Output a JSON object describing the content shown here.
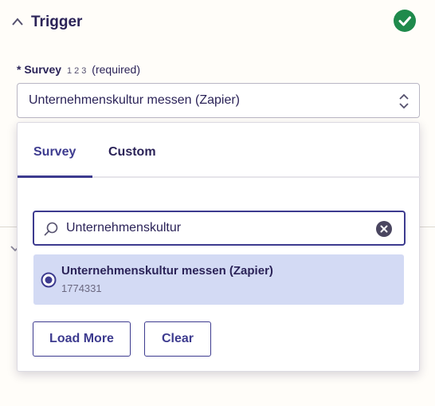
{
  "step": {
    "title": "Trigger",
    "status_icon": "check-circle-icon",
    "status_color": "#1f8a4c"
  },
  "field": {
    "required_marker": "*",
    "label": "Survey",
    "type_hint": "1 2 3",
    "required_text": "(required)",
    "selected_value": "Unternehmenskultur messen (Zapier)"
  },
  "dropdown": {
    "tabs": [
      {
        "label": "Survey",
        "active": true
      },
      {
        "label": "Custom",
        "active": false
      }
    ],
    "search": {
      "value": "Unternehmenskultur",
      "placeholder": ""
    },
    "results": [
      {
        "title": "Unternehmenskultur messen (Zapier)",
        "id": "1774331",
        "selected": true
      }
    ],
    "buttons": {
      "load_more": "Load More",
      "clear": "Clear"
    }
  },
  "colors": {
    "accent": "#3d3b8f",
    "text": "#2b2358",
    "selected_row": "#d3daf4"
  }
}
